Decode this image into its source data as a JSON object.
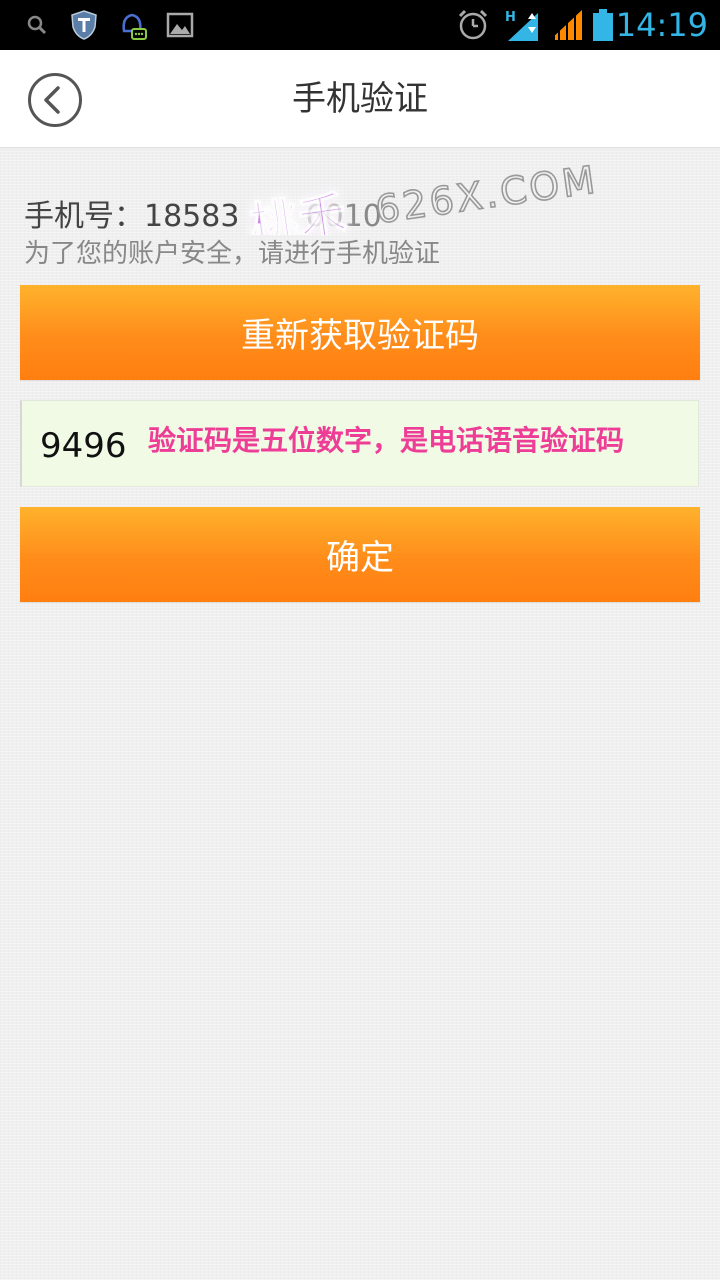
{
  "status_bar": {
    "time": "14:19",
    "icons": [
      "search-icon",
      "shield-icon",
      "qq-icon",
      "gallery-icon",
      "alarm-icon",
      "mobile-data-icon",
      "signal-icon",
      "battery-icon"
    ],
    "accent_color": "#33b5e5"
  },
  "header": {
    "title": "手机验证",
    "back_icon": "back-arrow-icon"
  },
  "account": {
    "phone_label": "手机号：",
    "phone_number": "18583",
    "phone_number_suffix": "6010",
    "hint": "为了您的账户安全，请进行手机验证"
  },
  "watermark": {
    "text_cn": "桃禾",
    "text_en": "626X.COM"
  },
  "actions": {
    "resend_label": "重新获取验证码",
    "confirm_label": "确定"
  },
  "code_input": {
    "value": "9496",
    "note": "验证码是五位数字，是电话语音验证码"
  },
  "colors": {
    "button_orange": "#ff8c1a",
    "input_bg": "#f1fae5",
    "note_pink": "#ee3d96"
  }
}
